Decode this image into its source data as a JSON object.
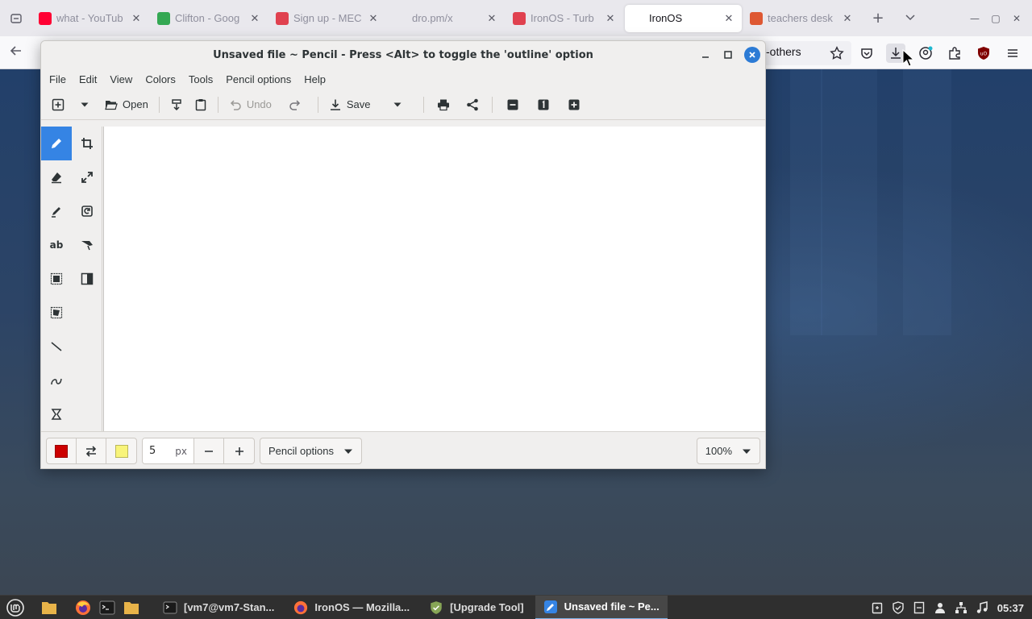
{
  "browser": {
    "tabs": [
      {
        "label": "what - YouTub",
        "favicon": "youtube-icon",
        "color": "#ff0033",
        "active": false
      },
      {
        "label": "Clifton - Goog",
        "favicon": "maps-pin-icon",
        "color": "#34a853",
        "active": false
      },
      {
        "label": "Sign up - MEC",
        "favicon": "mec-icon",
        "color": "#e0414f",
        "active": false
      },
      {
        "label": "dro.pm/x",
        "favicon": "",
        "color": "",
        "active": false
      },
      {
        "label": "IronOS - Turb",
        "favicon": "ironos-icon",
        "color": "#e0414f",
        "active": false
      },
      {
        "label": "IronOS",
        "favicon": "",
        "color": "",
        "active": true
      },
      {
        "label": "teachers desk",
        "favicon": "duckduckgo-icon",
        "color": "#de5833",
        "active": false
      }
    ],
    "url_tail": "-others"
  },
  "app": {
    "title": "Unsaved file ~ Pencil - Press <Alt> to toggle the 'outline' option",
    "menu": [
      "File",
      "Edit",
      "View",
      "Colors",
      "Tools",
      "Pencil options",
      "Help"
    ],
    "toolbar": {
      "open_label": "Open",
      "undo_label": "Undo",
      "save_label": "Save"
    },
    "tools": [
      {
        "name": "pencil",
        "active": true
      },
      {
        "name": "crop",
        "active": false
      },
      {
        "name": "eraser",
        "active": false
      },
      {
        "name": "scale",
        "active": false
      },
      {
        "name": "highlighter",
        "active": false
      },
      {
        "name": "rotate",
        "active": false
      },
      {
        "name": "text",
        "label": "ab",
        "active": false
      },
      {
        "name": "skew",
        "active": false
      },
      {
        "name": "rect-select",
        "active": false
      },
      {
        "name": "filters",
        "active": false
      },
      {
        "name": "free-select",
        "active": false
      },
      {
        "name": "line",
        "active": false
      },
      {
        "name": "curve",
        "active": false
      },
      {
        "name": "shape",
        "active": false
      }
    ],
    "bottom": {
      "main_color": "#cc0000",
      "secondary_color": "#f8f47a",
      "size_value": "5",
      "size_unit": "px",
      "options_label": "Pencil options",
      "zoom_label": "100%"
    }
  },
  "taskbar": {
    "tasks": [
      {
        "label": "[vm7@vm7-Stan...",
        "icon": "terminal-icon",
        "active": false
      },
      {
        "label": "IronOS — Mozilla...",
        "icon": "firefox-icon",
        "active": false
      },
      {
        "label": "[Upgrade Tool]",
        "icon": "shield-icon",
        "active": false
      },
      {
        "label": "Unsaved file ~ Pe...",
        "icon": "pencil-app-icon",
        "active": true
      }
    ],
    "clock": "05:37"
  }
}
